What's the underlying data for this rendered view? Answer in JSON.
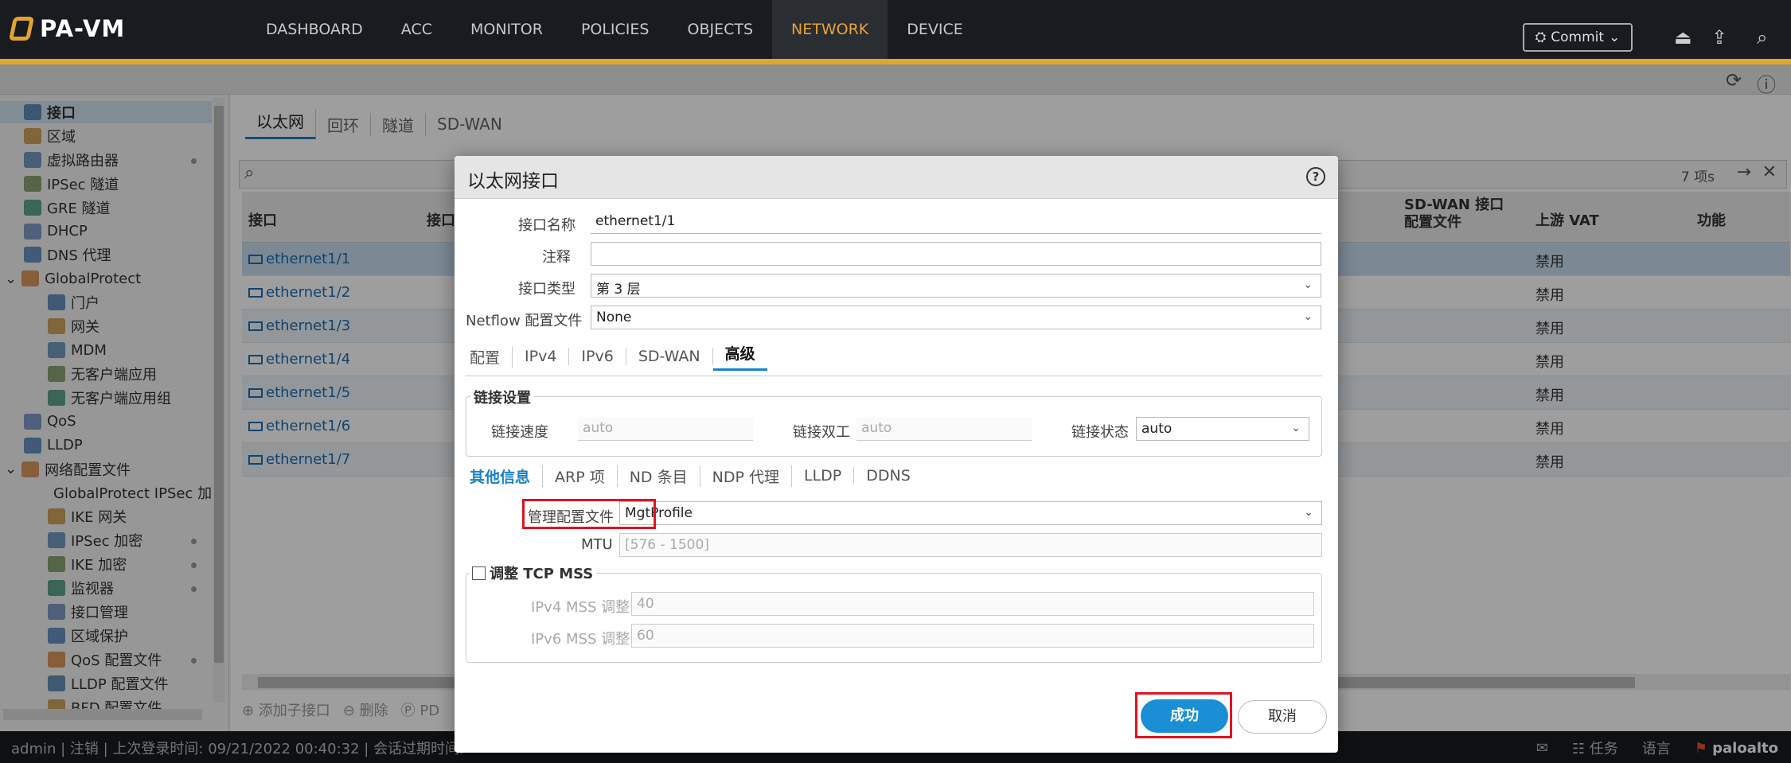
{
  "app": {
    "logo": "PA-VM"
  },
  "nav": {
    "items": [
      "DASHBOARD",
      "ACC",
      "MONITOR",
      "POLICIES",
      "OBJECTS",
      "NETWORK",
      "DEVICE"
    ],
    "active": "NETWORK",
    "commit_label": "Commit"
  },
  "sidebar": {
    "items": [
      {
        "label": "接口",
        "icon": "interface-icon",
        "selected": true,
        "level": 0
      },
      {
        "label": "区域",
        "icon": "zone-icon",
        "level": 0
      },
      {
        "label": "虚拟路由器",
        "icon": "router-icon",
        "dot": true,
        "level": 0
      },
      {
        "label": "IPSec 隧道",
        "icon": "ipsec-tunnel-icon",
        "level": 0
      },
      {
        "label": "GRE 隧道",
        "icon": "gre-tunnel-icon",
        "level": 0
      },
      {
        "label": "DHCP",
        "icon": "dhcp-icon",
        "level": 0
      },
      {
        "label": "DNS 代理",
        "icon": "dns-proxy-icon",
        "level": 0
      },
      {
        "label": "GlobalProtect",
        "icon": "globalprotect-icon",
        "level": 0,
        "expand": true
      },
      {
        "label": "门户",
        "icon": "portal-icon",
        "level": 1
      },
      {
        "label": "网关",
        "icon": "gateway-icon",
        "level": 1
      },
      {
        "label": "MDM",
        "icon": "mdm-icon",
        "level": 1
      },
      {
        "label": "无客户端应用",
        "icon": "clientless-app-icon",
        "level": 1
      },
      {
        "label": "无客户端应用组",
        "icon": "clientless-app-group-icon",
        "level": 1
      },
      {
        "label": "QoS",
        "icon": "qos-icon",
        "level": 0
      },
      {
        "label": "LLDP",
        "icon": "lldp-icon",
        "level": 0
      },
      {
        "label": "网络配置文件",
        "icon": "network-profiles-icon",
        "level": 0,
        "expand": true
      },
      {
        "label": "GlobalProtect IPSec 加",
        "icon": "lock-icon",
        "level": 1
      },
      {
        "label": "IKE 网关",
        "icon": "ike-gateway-icon",
        "level": 1
      },
      {
        "label": "IPSec 加密",
        "icon": "lock-icon",
        "dot": true,
        "level": 1
      },
      {
        "label": "IKE 加密",
        "icon": "lock-icon",
        "dot": true,
        "level": 1
      },
      {
        "label": "监视器",
        "icon": "monitor-icon",
        "dot": true,
        "level": 1
      },
      {
        "label": "接口管理",
        "icon": "interface-mgmt-icon",
        "level": 1
      },
      {
        "label": "区域保护",
        "icon": "zone-protection-icon",
        "level": 1
      },
      {
        "label": "QoS 配置文件",
        "icon": "qos-profile-icon",
        "dot": true,
        "level": 1
      },
      {
        "label": "LLDP 配置文件",
        "icon": "lldp-profile-icon",
        "level": 1
      },
      {
        "label": "BFD 配置文件",
        "icon": "bfd-profile-icon",
        "level": 1
      }
    ]
  },
  "content": {
    "tabs": [
      "以太网",
      "回环",
      "隧道",
      "SD-WAN"
    ],
    "active_tab": "以太网",
    "search": {
      "count": "7 项s"
    },
    "columns": {
      "interface": "接口",
      "col2": "接口",
      "sdwan": "SD-WAN 接口\n配置文件",
      "vat": "上游 VAT",
      "features": "功能"
    },
    "rows": [
      {
        "name": "ethernet1/1",
        "vat": "禁用"
      },
      {
        "name": "ethernet1/2",
        "vat": "禁用"
      },
      {
        "name": "ethernet1/3",
        "vat": "禁用"
      },
      {
        "name": "ethernet1/4",
        "vat": "禁用"
      },
      {
        "name": "ethernet1/5",
        "vat": "禁用"
      },
      {
        "name": "ethernet1/6",
        "vat": "禁用"
      },
      {
        "name": "ethernet1/7",
        "vat": "禁用"
      }
    ],
    "bottom_tools": {
      "add_sub": "添加子接口",
      "delete": "删除",
      "pdf": "PD"
    }
  },
  "status": {
    "user": "admin",
    "logout": "注销",
    "last_login": "上次登录时间: 09/21/2022 00:40:32",
    "session": "会话过期时间:",
    "tasks": "任务",
    "language": "语言",
    "brand": "paloalto"
  },
  "dialog": {
    "title": "以太网接口",
    "name_label": "接口名称",
    "name_value": "ethernet1/1",
    "comment_label": "注释",
    "comment_value": "",
    "type_label": "接口类型",
    "type_value": "第 3 层",
    "netflow_label": "Netflow 配置文件",
    "netflow_value": "None",
    "tabs": [
      "配置",
      "IPv4",
      "IPv6",
      "SD-WAN",
      "高级"
    ],
    "active_tab": "高级",
    "link_group": "链接设置",
    "link_speed_label": "链接速度",
    "link_speed_value": "auto",
    "link_duplex_label": "链接双工",
    "link_duplex_value": "auto",
    "link_state_label": "链接状态",
    "link_state_value": "auto",
    "subtabs": [
      "其他信息",
      "ARP 项",
      "ND 条目",
      "NDP 代理",
      "LLDP",
      "DDNS"
    ],
    "active_subtab": "其他信息",
    "mgmt_label": "管理配置文件",
    "mgmt_value": "MgtProfile",
    "mtu_label": "MTU",
    "mtu_placeholder": "[576 - 1500]",
    "tcp_mss_label": "调整 TCP MSS",
    "ipv4_mss_label": "IPv4 MSS 调整",
    "ipv4_mss_value": "40",
    "ipv6_mss_label": "IPv6 MSS 调整",
    "ipv6_mss_value": "60",
    "ok_label": "成功",
    "cancel_label": "取消"
  }
}
